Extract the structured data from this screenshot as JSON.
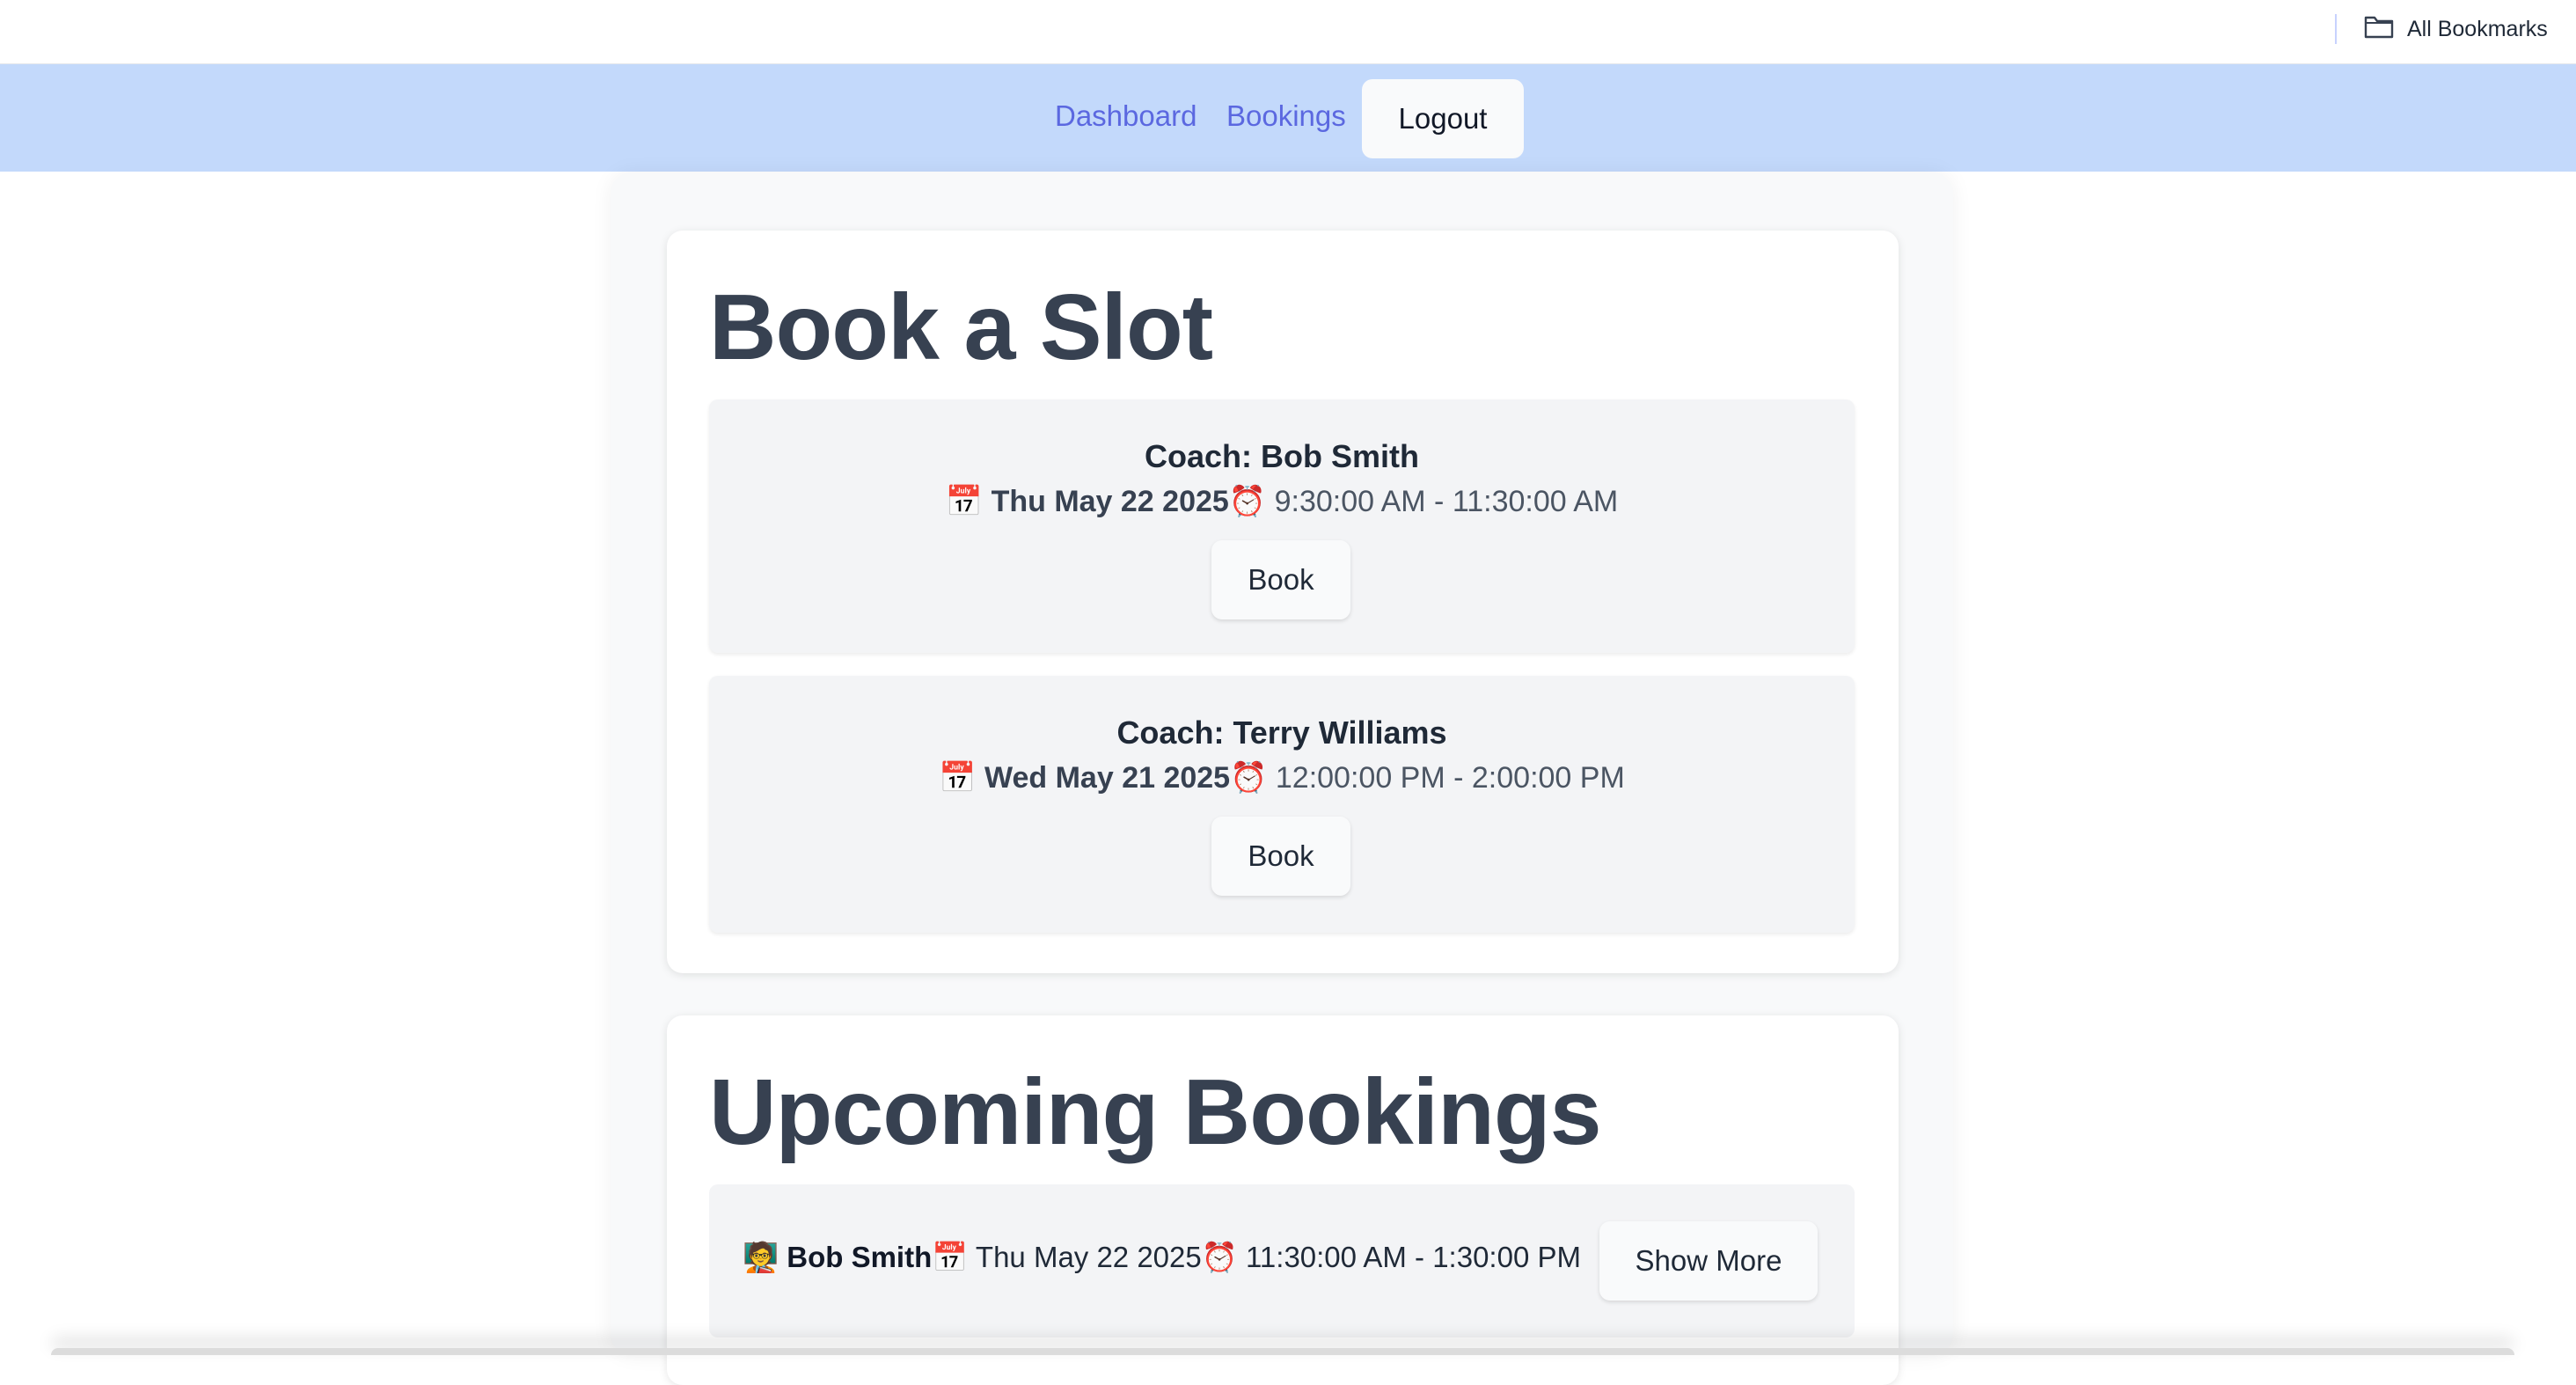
{
  "bookmarks_bar": {
    "all_bookmarks_label": "All Bookmarks",
    "icon": "folder-icon"
  },
  "nav": {
    "dashboard_label": "Dashboard",
    "bookings_label": "Bookings",
    "logout_label": "Logout"
  },
  "book_slot": {
    "title": "Book a Slot",
    "slots": [
      {
        "coach": "Coach: Bob Smith",
        "date_icon": "📅",
        "date": "Thu May 22 2025",
        "time_icon": "⏰",
        "time": " 9:30:00 AM - 11:30:00 AM",
        "button_label": "Book"
      },
      {
        "coach": "Coach: Terry Williams",
        "date_icon": "📅",
        "date": "Wed May 21 2025",
        "time_icon": "⏰",
        "time": " 12:00:00 PM - 2:00:00 PM",
        "button_label": "Book"
      }
    ]
  },
  "upcoming": {
    "title": "Upcoming Bookings",
    "bookings": [
      {
        "coach_icon": "🧑‍🏫",
        "coach": "Bob Smith",
        "date_icon": "📅",
        "date": " Thu May 22 2025",
        "time_icon": "⏰",
        "time": " 11:30:00 AM - 1:30:00 PM",
        "button_label": "Show More"
      }
    ]
  },
  "colors": {
    "nav_bg": "#c3d9fb",
    "nav_link": "#5b68e0",
    "heading": "#374151",
    "slot_bg": "#f3f4f6"
  }
}
